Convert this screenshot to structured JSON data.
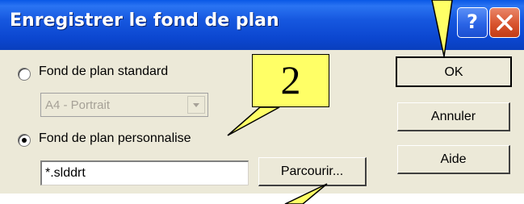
{
  "dialog": {
    "title": "Enregistrer le fond de plan",
    "help_label": "?",
    "radio_standard_label": "Fond de plan standard",
    "standard_combo_value": "A4 - Portrait",
    "radio_custom_label": "Fond de plan personnalise",
    "custom_file_value": "*.slddrt",
    "browse_label": "Parcourir...",
    "ok_label": "OK",
    "cancel_label": "Annuler",
    "help_button_label": "Aide",
    "selected_option": "custom"
  },
  "callout": {
    "label": "2"
  },
  "colors": {
    "titlebar": "#0b46cf",
    "dialog_bg": "#ece9d8",
    "callout_fill": "#ffff66",
    "close_button": "#d8542e",
    "help_button": "#2a64e6"
  },
  "icons": {
    "help": "question-mark-icon",
    "close": "close-x-icon",
    "combo_arrow": "chevron-down-icon"
  }
}
